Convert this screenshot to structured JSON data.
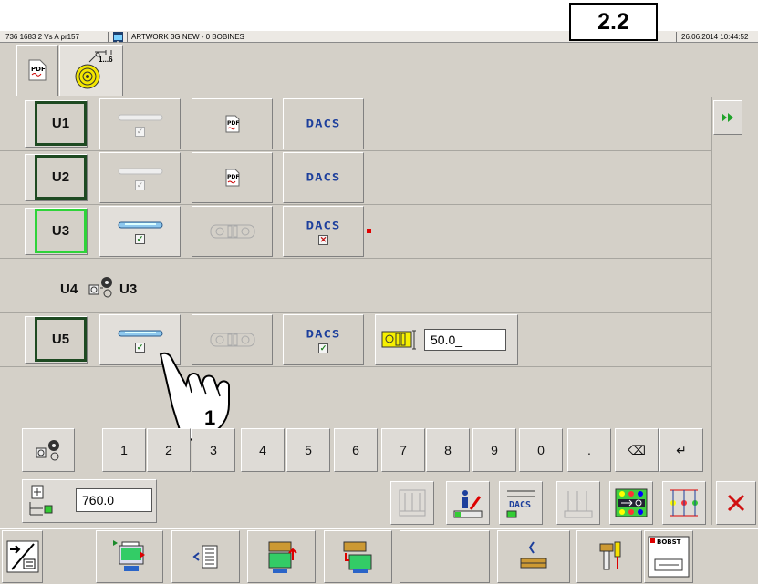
{
  "titlebar": {
    "job": "736 1683 2 Vs A pr157",
    "artwork": "ARTWORK 3G NEW - 0 BOBINES",
    "datetime": "26.06.2014 10:44:52",
    "sheet_id": "2.2"
  },
  "tabs": [
    {
      "icon": "pdf-icon"
    },
    {
      "icon": "reel-sequence-icon",
      "label": "1...6"
    }
  ],
  "units": [
    {
      "label": "U1",
      "active": false,
      "shaft_state": "disabled",
      "has_pdf": true,
      "dacs": "DACS"
    },
    {
      "label": "U2",
      "active": false,
      "shaft_state": "disabled",
      "has_pdf": true,
      "dacs": "DACS"
    },
    {
      "label": "U3",
      "active": true,
      "shaft_state": "checked",
      "sleeve": true,
      "dacs": "DACS",
      "dacs_state": "error"
    },
    {
      "label": "U5",
      "active": false,
      "shaft_state": "checked",
      "sleeve": true,
      "dacs": "DACS",
      "dacs_state": "checked"
    }
  ],
  "u4_row": {
    "from": "U4",
    "to": "U3"
  },
  "u5_value": "50.0_",
  "callout_number": "1",
  "keypad": {
    "keys": [
      "1",
      "2",
      "3",
      "4",
      "5",
      "6",
      "7",
      "8",
      "9",
      "0",
      "."
    ],
    "backspace": "⌫",
    "enter": "↵"
  },
  "width_value": "760.0",
  "colors": {
    "panel": "#d4d0c8",
    "active_green": "#2fd33a",
    "dark_green": "#1e4a22",
    "dacs_blue": "#1d3f9c",
    "close_red": "#d01010"
  }
}
